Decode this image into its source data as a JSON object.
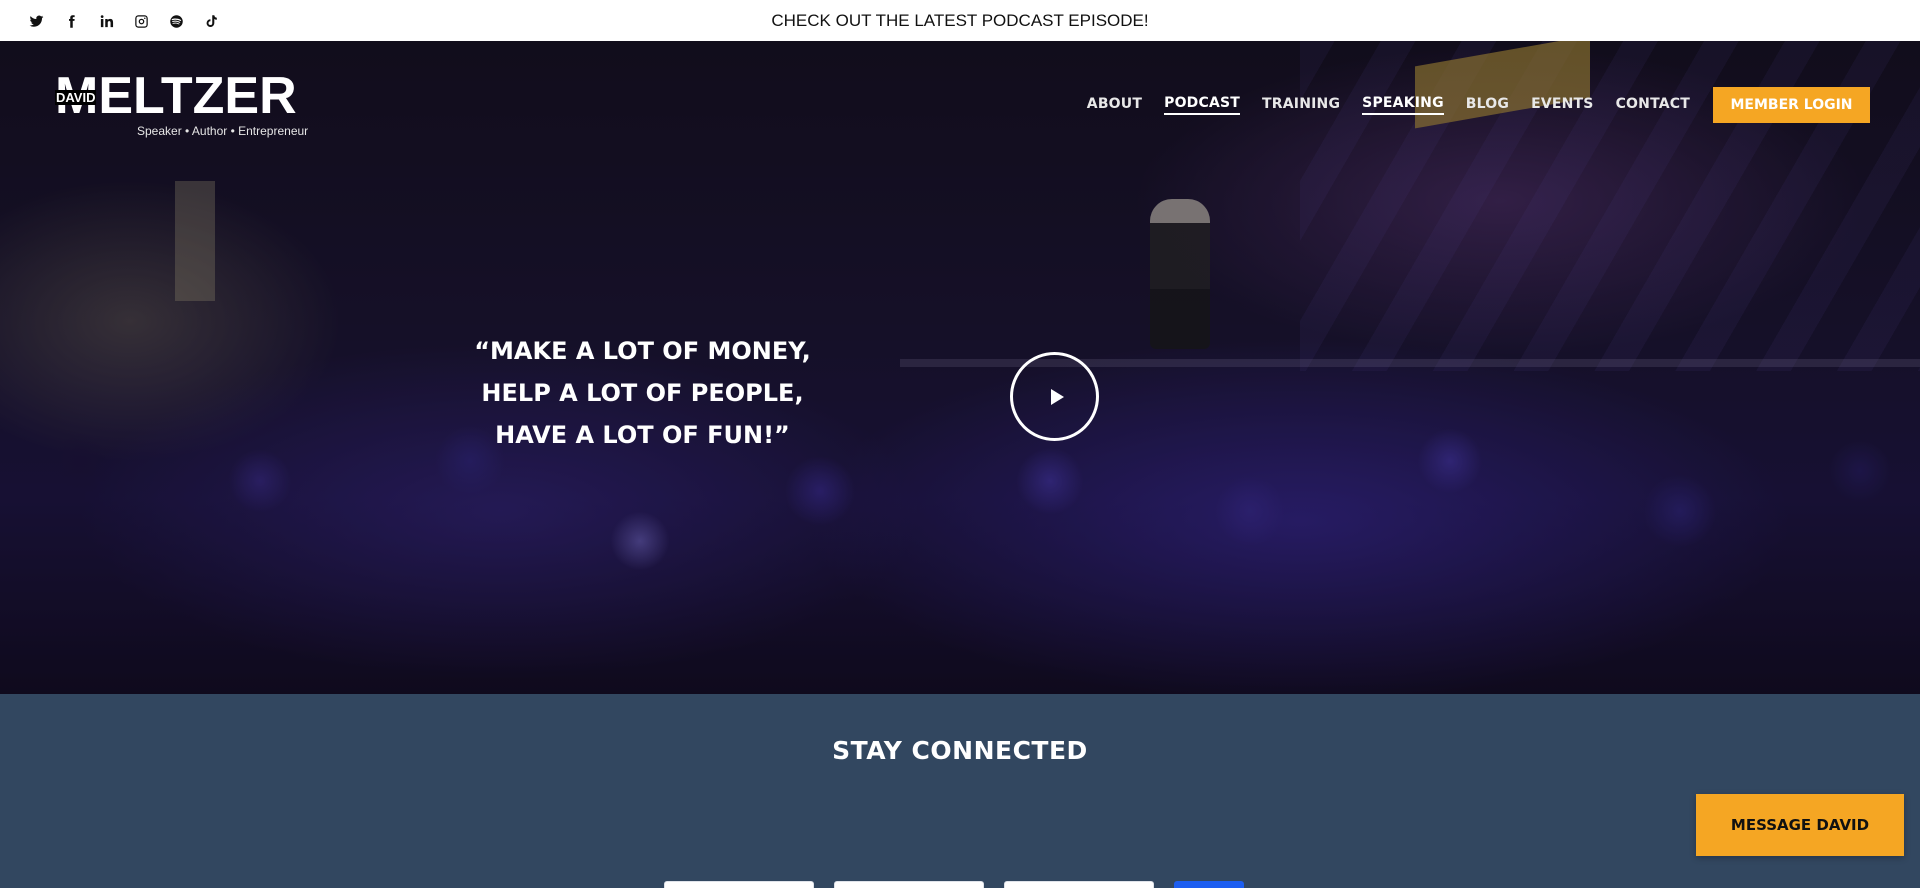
{
  "topbar": {
    "announcement": "CHECK OUT THE LATEST PODCAST EPISODE!",
    "social_icons": [
      "twitter-icon",
      "facebook-icon",
      "linkedin-icon",
      "instagram-icon",
      "spotify-icon",
      "tiktok-icon"
    ]
  },
  "logo": {
    "first_name": "DAVID",
    "last_name": "MELTZER",
    "tagline": "Speaker • Author • Entrepreneur"
  },
  "nav": {
    "items": [
      {
        "label": "ABOUT",
        "active": false
      },
      {
        "label": "PODCAST",
        "active": true
      },
      {
        "label": "TRAINING",
        "active": false
      },
      {
        "label": "SPEAKING",
        "active": true
      },
      {
        "label": "BLOG",
        "active": false
      },
      {
        "label": "EVENTS",
        "active": false
      },
      {
        "label": "CONTACT",
        "active": false
      }
    ],
    "login_label": "MEMBER LOGIN"
  },
  "hero": {
    "quote_lines": [
      "“MAKE A LOT OF MONEY,",
      "HELP A LOT OF PEOPLE,",
      "HAVE A LOT OF FUN!”"
    ],
    "play_icon": "play-icon"
  },
  "connect": {
    "title": "STAY CONNECTED"
  },
  "message_button": "MESSAGE DAVID",
  "colors": {
    "accent": "#f5a623",
    "section_bg": "#324760",
    "submit": "#1d5ef0"
  }
}
